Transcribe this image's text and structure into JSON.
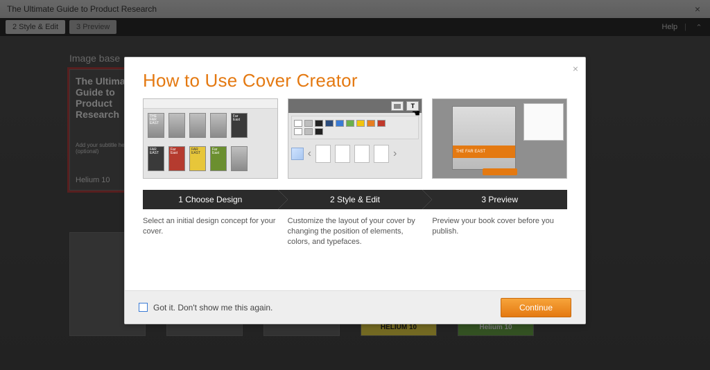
{
  "window": {
    "title": "The Ultimate Guide to Product Research",
    "close_glyph": "×"
  },
  "stepbar": {
    "step2": "2 Style & Edit",
    "step3": "3 Preview",
    "help": "Help",
    "collapse_glyph": "⌃"
  },
  "canvas": {
    "section_label": "Image base",
    "cover1": {
      "title": "The Ultimate Guide to Product Research",
      "subtitle": "Add your subtitle here (optional)",
      "brand": "Helium 10"
    },
    "row2": {
      "brand_helium_caps": "HELIUM 10",
      "brand_helium": "Helium 10"
    }
  },
  "modal": {
    "close_glyph": "×",
    "title": "How to Use Cover Creator",
    "shot3_band": "THE FAR EAST",
    "steps": {
      "s1": {
        "ribbon": "1 Choose Design",
        "desc": "Select an initial design concept for your cover."
      },
      "s2": {
        "ribbon": "2  Style & Edit",
        "desc": "Customize the layout of your cover by changing the position of elements, colors, and typefaces."
      },
      "s3": {
        "ribbon": "3  Preview",
        "desc": "Preview your book cover before you publish."
      }
    },
    "mini_labels": {
      "far_east": "THE FAR EAST",
      "far": "Far East",
      "fe": "FAR EAST"
    },
    "footer": {
      "dont_show": "Got it. Don't show me this again.",
      "continue": "Continue"
    }
  }
}
